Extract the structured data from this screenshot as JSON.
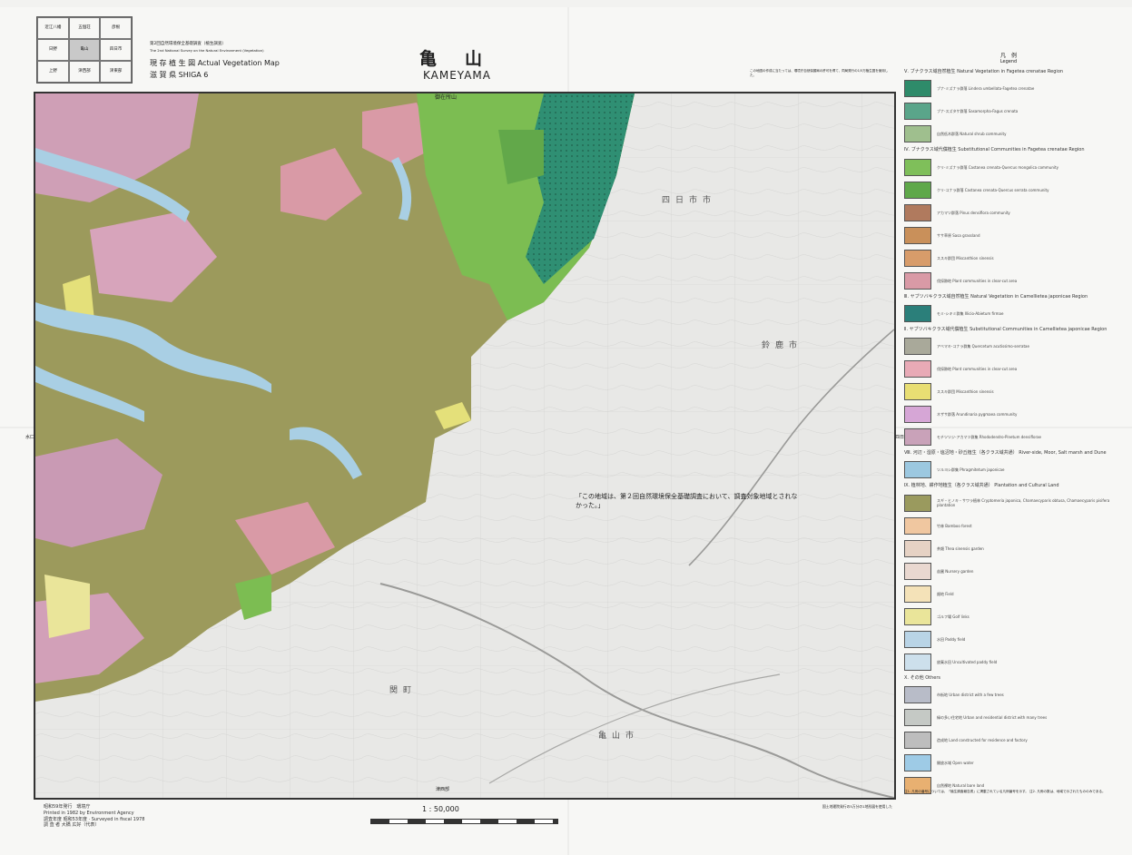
{
  "index_map": {
    "cells": [
      "近江八幡",
      "五個荘",
      "彦根",
      "日野",
      "亀山",
      "四日市",
      "上野",
      "津西部",
      "津東部"
    ]
  },
  "header": {
    "survey_line1": "第2回自然環境保全基礎調査（植生調査）",
    "survey_line2": "The 2nd National Survey on the Natural Environment (Vegetation)",
    "map_type": "現 存 植 生 図  Actual Vegetation Map",
    "prefecture": "滋 賀 県 SHIGA 6",
    "title_jp": "亀　山",
    "title_en": "KAMEYAMA",
    "top_right_note": "この地図の作成に当たっては、環境庁自然保護局の許可を得て、同局発行の1/5万植生図を使用した。"
  },
  "map": {
    "top_label": "御在所山",
    "left_label": "水口",
    "right_label": "四日市",
    "bottom_label": "津西部",
    "notice": "「この地域は、第２回自然環境保全基礎調査において、調査対象地域とされなかった。」",
    "place_labels": [
      "四日市市",
      "鈴鹿市",
      "亀山市",
      "関町"
    ]
  },
  "legend": {
    "title_jp": "凡　例",
    "title_en": "Legend",
    "sections": [
      {
        "heading": "Ⅴ. ブナクラス域自然植生 Natural Vegetation in Fagetea crenatae Region",
        "items": [
          {
            "label": "ブナ-ミズナラ群落 Lindera umbellata-Fagetea crenatae",
            "color": "#2e8b6a"
          },
          {
            "label": "ブナ-スズタケ群落 Sasamorpha-Fagus crenata",
            "color": "#5aa58a"
          },
          {
            "label": "自然低木群落 Natural shrub community",
            "color": "#9fbf8e"
          }
        ]
      },
      {
        "heading": "Ⅳ. ブナクラス域代償植生 Substitutional Communities in Fagetea crenatae Region",
        "items": [
          {
            "label": "クリ-ミズナラ群落 Castanea crenata-Quercus mongolica community",
            "color": "#7fbf5a"
          },
          {
            "label": "クリ-コナラ群落 Castanea crenata-Quercus serrata community",
            "color": "#5fa84a"
          },
          {
            "label": "アカマツ群落 Pinus densiflora community",
            "color": "#b07a5e"
          },
          {
            "label": "ササ草原 Sasa grassland",
            "color": "#c9905a"
          },
          {
            "label": "ススキ群団 Miscanthion sinensis",
            "color": "#d89c6a"
          },
          {
            "label": "伐採跡地 Plant communities in clear-cut area",
            "color": "#d99aa6"
          }
        ]
      },
      {
        "heading": "Ⅲ. ヤブツバキクラス域自然植生 Natural Vegetation in Camellietea japonicae Region",
        "items": [
          {
            "label": "モミ-シキミ群集 Illicio-Abietum firmae",
            "color": "#2b7f7a"
          }
        ]
      },
      {
        "heading": "Ⅱ. ヤブツバキクラス域代償植生 Substitutional Communities in Camellietea japonicae Region",
        "items": [
          {
            "label": "アベマキ-コナラ群集 Quercetum acutissimo-serratae",
            "color": "#a9a99a"
          },
          {
            "label": "伐採跡地 Plant communities in clear-cut area",
            "color": "#e8aab6"
          },
          {
            "label": "ススキ群団 Miscanthion sinensis",
            "color": "#e8de73"
          },
          {
            "label": "ネザサ群落 Arundinaria pygmaea community",
            "color": "#d6a6d6"
          },
          {
            "label": "モチツツジ-アカマツ群集 Rhododendro-Pinetum densiflorae",
            "color": "#c9a2b9"
          }
        ]
      },
      {
        "heading": "Ⅷ. 河辺・湿原・塩沼地・砂丘植生（各クラス域共通） River-side, Moor, Salt marsh and Dune",
        "items": [
          {
            "label": "ツルヨシ群集 Phragmitetum japonicae",
            "color": "#9cc8e0"
          }
        ]
      },
      {
        "heading": "Ⅸ. 植林地、耕作地植生（各クラス域共通） Plantation and Cultural Land",
        "items": [
          {
            "label": "スギ・ヒノキ・サワラ植林 Cryptomeria japonica, Chamaecyparis obtusa, Chamaecyparis pisifera plantation",
            "color": "#9a9a5e"
          },
          {
            "label": "竹林 Bamboo forest",
            "color": "#f0c7a0"
          },
          {
            "label": "茶畑 Thea sinensis garden",
            "color": "#e6d2c4"
          },
          {
            "label": "苗圃 Nursery garden",
            "color": "#e9d8d0"
          },
          {
            "label": "畑地 Field",
            "color": "#f4e2b8"
          },
          {
            "label": "ゴルフ場 Golf links",
            "color": "#eae59a"
          },
          {
            "label": "水田 Paddy field",
            "color": "#b9d4e6"
          },
          {
            "label": "放棄水田 Uncultivated paddy field",
            "color": "#cde0ec"
          }
        ]
      },
      {
        "heading": "Ⅹ. その他 Others",
        "items": [
          {
            "label": "市街地 Urban district with a few trees",
            "color": "#b8bcc8"
          },
          {
            "label": "緑の多い住宅地 Urban and residential district with many trees",
            "color": "#c5c9c5"
          },
          {
            "label": "造成地 Land constructed for residence and factory",
            "color": "#bdbdbd"
          },
          {
            "label": "開放水域 Open water",
            "color": "#9ecbe6"
          },
          {
            "label": "自然裸地 Natural bare land",
            "color": "#e8b071"
          }
        ]
      }
    ],
    "bottom_note": "注1. 凡例の番号については、「植生調査報告書」に掲載されている凡例番号を示す。 注2. 凡例の数は、地域で示されたもののみである。"
  },
  "footer": {
    "published": "昭和59年発行　環境庁",
    "printed": "Printed in 1982 by Environment Agency",
    "surveyed": "調査年度 昭和53年度 · Surveyed in fiscal 1978",
    "investigator": "調 査 者 大橋 広好（代表）",
    "scale": "1 : 50,000",
    "base_map_note": "国土地理院発行の5万分の1地形図を使用した"
  },
  "colors": {
    "land_olive": "#9a9a5e",
    "land_pink": "#d2a0b8",
    "water": "#a9cfe4",
    "forest_green": "#7cbd52",
    "dark_teal": "#2f8f73",
    "yellow": "#e4e07a",
    "bg_map": "#e7e7e5"
  }
}
